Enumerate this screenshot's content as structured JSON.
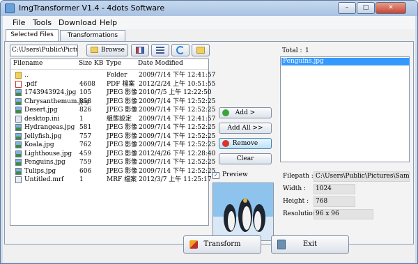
{
  "window": {
    "title": "ImgTransformer V1.4 - 4dots Software",
    "minimize": "–",
    "maximize": "□",
    "close": "✕"
  },
  "menu": [
    "File",
    "Tools",
    "Download",
    "Help"
  ],
  "tabs": [
    {
      "label": "Selected Files"
    },
    {
      "label": "Transformations"
    }
  ],
  "toolbar": {
    "path": "C:\\Users\\Public\\Pictures\\Sa",
    "browse_label": "Browse"
  },
  "filelist": {
    "headers": {
      "filename": "Filename",
      "size": "Size KB",
      "type": "Type",
      "date": "Date Modified"
    },
    "rows": [
      {
        "name": "..",
        "size": "",
        "type": "Folder",
        "date": "2009/7/14 下午 12:41:57",
        "icon": "folder-icon"
      },
      {
        "name": ".pdf",
        "size": "4608",
        "type": "PDF 檔案",
        "date": "2012/2/24 上午 10:51:55",
        "icon": "pdf-file-icon"
      },
      {
        "name": "1743943924.jpg",
        "size": "105",
        "type": "JPEG 影像",
        "date": "2010/7/5 上午 12:22:50",
        "icon": "image-file-icon"
      },
      {
        "name": "Chrysanthemum.jpg",
        "size": "858",
        "type": "JPEG 影像",
        "date": "2009/7/14 下午 12:52:25",
        "icon": "image-file-icon"
      },
      {
        "name": "Desert.jpg",
        "size": "826",
        "type": "JPEG 影像",
        "date": "2009/7/14 下午 12:52:25",
        "icon": "image-file-icon"
      },
      {
        "name": "desktop.ini",
        "size": "1",
        "type": "組態設定",
        "date": "2009/7/14 下午 12:41:57",
        "icon": "settings-file-icon"
      },
      {
        "name": "Hydrangeas.jpg",
        "size": "581",
        "type": "JPEG 影像",
        "date": "2009/7/14 下午 12:52:25",
        "icon": "image-file-icon"
      },
      {
        "name": "Jellyfish.jpg",
        "size": "757",
        "type": "JPEG 影像",
        "date": "2009/7/14 下午 12:52:25",
        "icon": "image-file-icon"
      },
      {
        "name": "Koala.jpg",
        "size": "762",
        "type": "JPEG 影像",
        "date": "2009/7/14 下午 12:52:25",
        "icon": "image-file-icon"
      },
      {
        "name": "Lighthouse.jpg",
        "size": "459",
        "type": "JPEG 影像",
        "date": "2012/4/26 下午 12:28:40",
        "icon": "image-file-icon"
      },
      {
        "name": "Penguins.jpg",
        "size": "759",
        "type": "JPEG 影像",
        "date": "2009/7/14 下午 12:52:25",
        "icon": "image-file-icon"
      },
      {
        "name": "Tulips.jpg",
        "size": "606",
        "type": "JPEG 影像",
        "date": "2009/7/14 下午 12:52:25",
        "icon": "image-file-icon"
      },
      {
        "name": "Untitled.mrf",
        "size": "1",
        "type": "MRF 檔案",
        "date": "2012/3/7 上午 11:25:17",
        "icon": "generic-file-icon"
      }
    ]
  },
  "actions": {
    "add": "Add >",
    "add_all": "Add All >>",
    "remove": "Remove",
    "clear": "Clear"
  },
  "preview": {
    "label": "Preview",
    "checked": "✓"
  },
  "selected": {
    "total_label": "Total :",
    "total_value": "1",
    "items": [
      "Penguins.jpg"
    ]
  },
  "info": {
    "filepath_label": "Filepath :",
    "filepath_value": "C:\\Users\\Public\\Pictures\\Sample Pictur",
    "width_label": "Width :",
    "width_value": "1024",
    "height_label": "Height :",
    "height_value": "768",
    "resolution_label": "Resolution :",
    "resolution_value": "96 x 96"
  },
  "footer": {
    "transform_label": "Transform",
    "exit_label": "Exit"
  },
  "colors": {
    "selection": "#3399ff",
    "add_icon": "#3aa43a",
    "remove_icon": "#d9342b"
  }
}
